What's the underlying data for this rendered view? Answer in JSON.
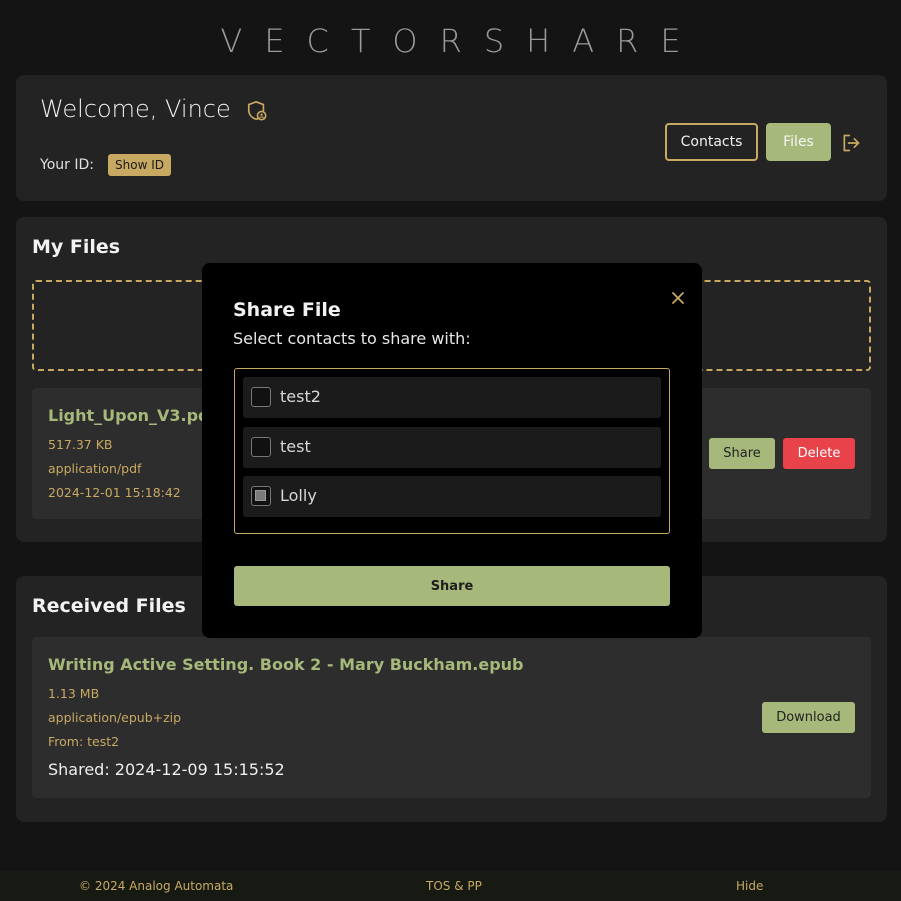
{
  "brand": "VECTORSHARE",
  "header": {
    "welcome": "Welcome, Vince",
    "id_label": "Your ID:",
    "show_id": "Show ID",
    "contacts": "Contacts",
    "files": "Files"
  },
  "my_files": {
    "title": "My Files",
    "items": [
      {
        "name": "Light_Upon_V3.pdf",
        "size": "517.37 KB",
        "type": "application/pdf",
        "date": "2024-12-01 15:18:42",
        "share": "Share",
        "delete": "Delete"
      }
    ]
  },
  "received_files": {
    "title": "Received Files",
    "items": [
      {
        "name": "Writing Active Setting. Book 2 - Mary Buckham.epub",
        "size": "1.13 MB",
        "type": "application/epub+zip",
        "from": "From: test2",
        "shared": "Shared: 2024-12-09 15:15:52",
        "download": "Download"
      }
    ]
  },
  "modal": {
    "title": "Share File",
    "subtitle": "Select contacts to share with:",
    "contacts": [
      {
        "name": "test2",
        "checked": false
      },
      {
        "name": "test",
        "checked": false
      },
      {
        "name": "Lolly",
        "checked": true
      }
    ],
    "share_button": "Share"
  },
  "footer": {
    "copyright": "© 2024 Analog Automata",
    "tos": "TOS & PP",
    "hide": "Hide"
  },
  "colors": {
    "accent_gold": "#c8a962",
    "accent_green": "#a6b97a",
    "danger": "#e8434a",
    "background": "#141414",
    "card": "#232323"
  },
  "icons": {
    "shield": "shield-user-icon",
    "logout": "logout-icon",
    "close": "close-icon"
  }
}
